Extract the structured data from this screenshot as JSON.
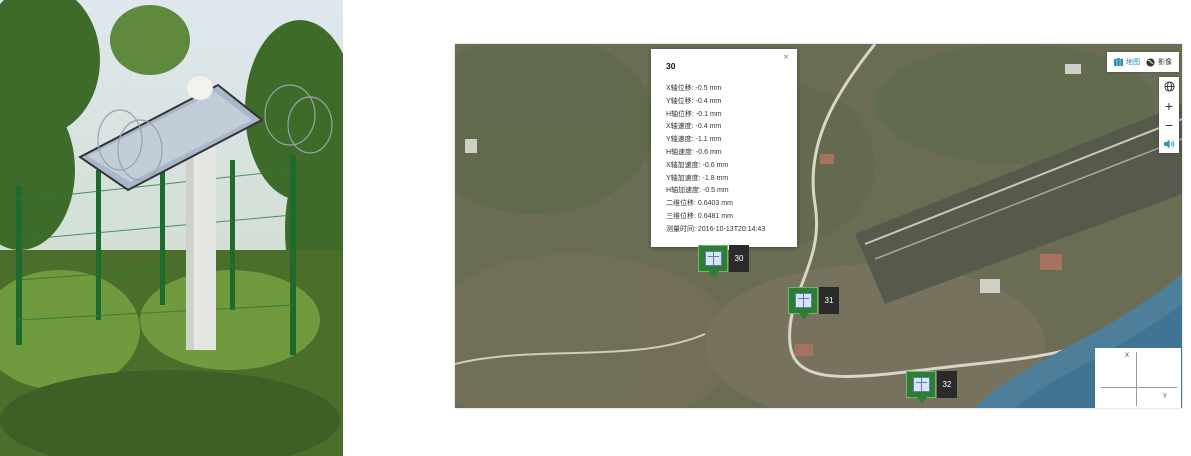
{
  "popup": {
    "title": "30",
    "close": "×",
    "rows": [
      "X轴位移: -0.5 mm",
      "Y轴位移: -0.4 mm",
      "H轴位移: -0.1 mm",
      "X轴速度: -0.4 mm",
      "Y轴速度: -1.1 mm",
      "H轴速度: -0.6 mm",
      "X轴加速度: -0.6 mm",
      "Y轴加速度: -1.8 mm",
      "H轴加速度: -0.5 mm",
      "二维位移: 0.6403 mm",
      "三维位移: 0.6481 mm",
      "测量时间: 2016-10-13T20:14:43"
    ]
  },
  "markers": [
    {
      "label": "30"
    },
    {
      "label": "31"
    },
    {
      "label": "32"
    }
  ],
  "layer_switch": {
    "map_label": "地图",
    "image_label": "影像",
    "active": "map"
  },
  "zoom": {
    "globe_icon": "globe-icon",
    "zoom_in": "+",
    "zoom_out": "−",
    "sound_icon": "speaker-icon"
  },
  "axes": {
    "x_label": "X",
    "y_label": "Y"
  },
  "colors": {
    "accent": "#2a8fbd",
    "marker_green": "#2e7d32",
    "marker_label_bg": "#2a2a2a"
  }
}
